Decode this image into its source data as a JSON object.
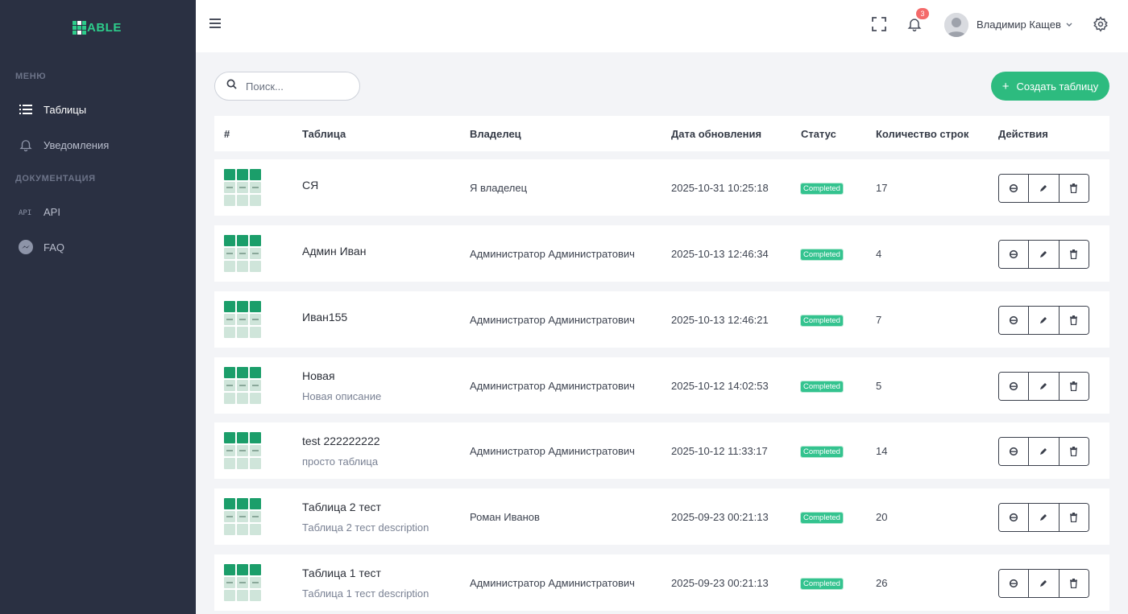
{
  "app": {
    "logo_text": "ABLE",
    "brand_color": "#2dcc8b"
  },
  "sidebar": {
    "sections": [
      {
        "label": "МЕНЮ"
      },
      {
        "label": "ДОКУМЕНТАЦИЯ"
      }
    ],
    "items": [
      {
        "label": "Таблицы",
        "icon": "list-icon",
        "active": true
      },
      {
        "label": "Уведомления",
        "icon": "bell-icon",
        "active": false
      },
      {
        "label": "API",
        "icon": "api-icon",
        "active": false
      },
      {
        "label": "FAQ",
        "icon": "messenger-icon",
        "active": false
      }
    ]
  },
  "header": {
    "notifications_count": "3",
    "user_name": "Владимир Кащев",
    "icons": [
      "menu-icon",
      "fullscreen-icon",
      "bell-icon",
      "settings-icon"
    ]
  },
  "toolbar": {
    "search_placeholder": "Поиск...",
    "create_label": "Создать таблицу"
  },
  "table": {
    "headers": {
      "num": "#",
      "table": "Таблица",
      "owner": "Владелец",
      "updated": "Дата обновления",
      "status": "Статус",
      "rows_count": "Количество строк",
      "actions": "Действия"
    },
    "rows": [
      {
        "name": "СЯ",
        "description": "",
        "owner": "Я владелец",
        "updated": "2025-10-31 10:25:18",
        "status": "Completed",
        "rows_count": "17"
      },
      {
        "name": "Админ Иван",
        "description": "",
        "owner": "Администратор Администратович",
        "updated": "2025-10-13 12:46:34",
        "status": "Completed",
        "rows_count": "4"
      },
      {
        "name": "Иван155",
        "description": "",
        "owner": "Администратор Администратович",
        "updated": "2025-10-13 12:46:21",
        "status": "Completed",
        "rows_count": "7"
      },
      {
        "name": "Новая",
        "description": "Новая описание",
        "owner": "Администратор Администратович",
        "updated": "2025-10-12 14:02:53",
        "status": "Completed",
        "rows_count": "5"
      },
      {
        "name": "test 222222222",
        "description": "просто таблица",
        "owner": "Администратор Администратович",
        "updated": "2025-10-12 11:33:17",
        "status": "Completed",
        "rows_count": "14"
      },
      {
        "name": "Таблица 2 тест",
        "description": "Таблица 2 тест description",
        "owner": "Роман Иванов",
        "updated": "2025-09-23 00:21:13",
        "status": "Completed",
        "rows_count": "20"
      },
      {
        "name": "Таблица 1 тест",
        "description": "Таблица 1 тест description",
        "owner": "Администратор Администратович",
        "updated": "2025-09-23 00:21:13",
        "status": "Completed",
        "rows_count": "26"
      }
    ],
    "row_actions": [
      "browser-icon",
      "edit-icon",
      "trash-icon"
    ]
  }
}
